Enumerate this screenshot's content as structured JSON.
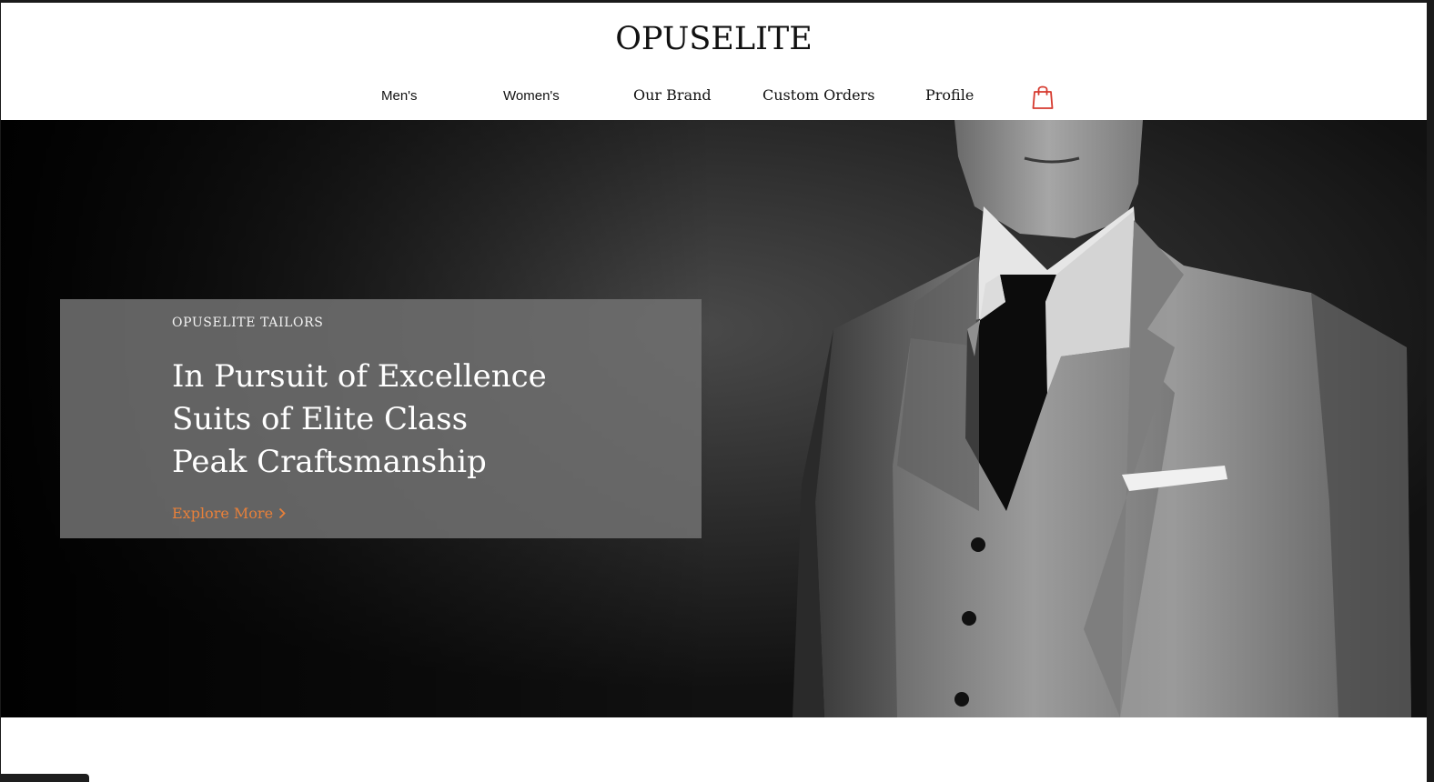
{
  "brand": {
    "logo_text": "OPUSELITE"
  },
  "nav": {
    "items": [
      {
        "label": "Men's"
      },
      {
        "label": "Women's"
      },
      {
        "label": "Our Brand"
      },
      {
        "label": "Custom Orders"
      },
      {
        "label": "Profile"
      }
    ],
    "cart_icon": "shopping-bag-icon",
    "cart_icon_color": "#d63a2f"
  },
  "hero": {
    "eyebrow": "OPUSELITE TAILORS",
    "headline_lines": [
      "In Pursuit of Excellence",
      "Suits of Elite Class",
      "Peak Craftsmanship"
    ],
    "cta_label": "Explore More",
    "cta_icon": "chevron-right-icon",
    "cta_color": "#e8803a",
    "image_description_icon": "hero-photo"
  }
}
